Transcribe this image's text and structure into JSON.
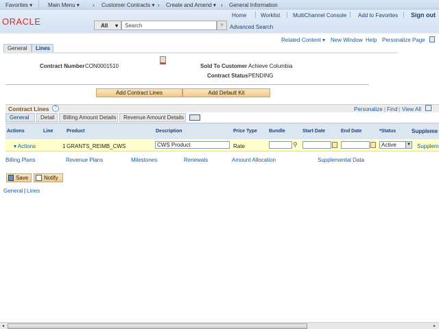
{
  "nav": {
    "items": [
      "Favorites ▾",
      "Main Menu ▾",
      "Customer Contracts ▾",
      "Create and Amend ▾",
      "General Information"
    ],
    "sep": "›"
  },
  "header": {
    "links": [
      "Home",
      "Worklist",
      "MultiChannel Console",
      "Add to Favorites"
    ],
    "signout": "Sign out",
    "logo": "ORACLE",
    "search_scope": "All",
    "search_placeholder": "Search",
    "search_go": "»",
    "advanced": "Advanced Search"
  },
  "toolbar": {
    "related": "Related Content ▾",
    "new_window": "New Window",
    "help": "Help",
    "personalize": "Personalize Page"
  },
  "page_tabs": [
    "General",
    "Lines"
  ],
  "contract": {
    "number_label": "Contract Number",
    "number": "CON0001510",
    "customer_label": "Sold To Customer",
    "customer": "Achieve Columbia",
    "status_label": "Contract Status",
    "status": "PENDING"
  },
  "buttons": {
    "add_lines": "Add Contract Lines",
    "add_kit": "Add Default Kit",
    "save": "Save",
    "notify": "Notify"
  },
  "grid": {
    "title": "Contract Lines",
    "help": "?",
    "personalize": "Personalize",
    "find": "Find",
    "view_all": "View All",
    "tabs": [
      "General",
      "Detail",
      "Billing Amount Details",
      "Revenue Amount Details"
    ],
    "columns": [
      "Actions",
      "Line",
      "Product",
      "Description",
      "Price Type",
      "Bundle",
      "Start Date",
      "End Date",
      "*Status",
      "Suppleme"
    ],
    "row": {
      "actions": "▾ Actions",
      "line": "1",
      "product": "GRANTS_REIMB_CWS",
      "description": "CWS Product",
      "price_type": "Rate",
      "bundle": "",
      "start": "",
      "end": "",
      "status": "Active",
      "supp": "Suppleme"
    }
  },
  "sublinks": [
    "Billing Plans",
    "Revenue Plans",
    "Milestones",
    "Renewals",
    "Amount Allocation",
    "Supplemental Data"
  ],
  "footer": {
    "general": "General",
    "sep": "|",
    "lines": "Lines"
  },
  "colors": {
    "accent": "#1a5a9a",
    "logo": "#e0261d",
    "row_bg": "#ffffcc"
  }
}
